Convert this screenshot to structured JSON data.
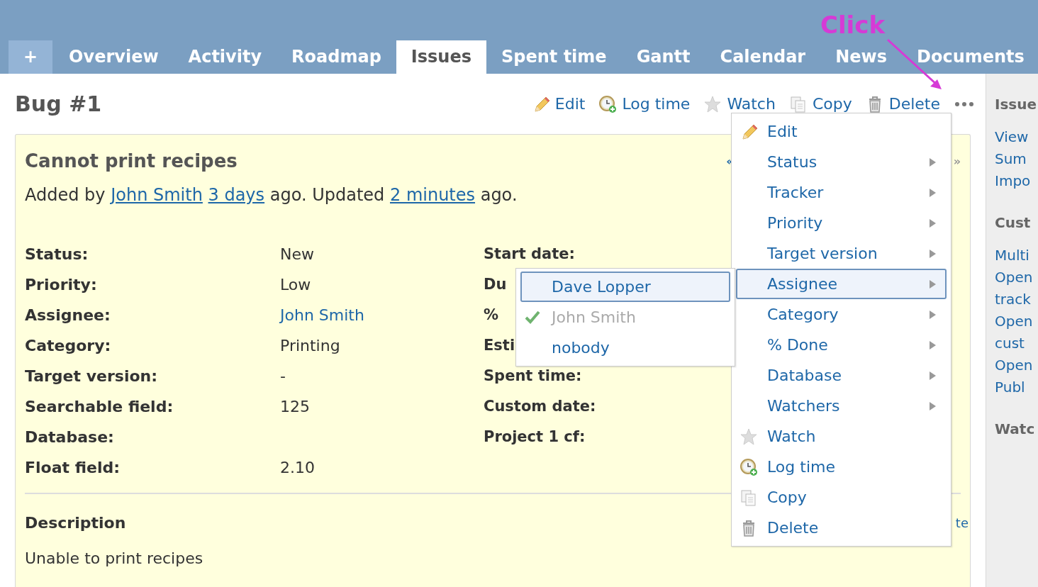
{
  "tabs": [
    {
      "label": "+",
      "kind": "new",
      "selected": false
    },
    {
      "label": "Overview",
      "kind": "tab",
      "selected": false
    },
    {
      "label": "Activity",
      "kind": "tab",
      "selected": false
    },
    {
      "label": "Roadmap",
      "kind": "tab",
      "selected": false
    },
    {
      "label": "Issues",
      "kind": "tab",
      "selected": true
    },
    {
      "label": "Spent time",
      "kind": "tab",
      "selected": false
    },
    {
      "label": "Gantt",
      "kind": "tab",
      "selected": false
    },
    {
      "label": "Calendar",
      "kind": "tab",
      "selected": false
    },
    {
      "label": "News",
      "kind": "tab",
      "selected": false
    },
    {
      "label": "Documents",
      "kind": "tab",
      "selected": false
    }
  ],
  "annotation": {
    "text": "Click"
  },
  "issue": {
    "title": "Bug #1",
    "actions": [
      {
        "label": "Edit",
        "kind": "pencil"
      },
      {
        "label": "Log time",
        "kind": "clock"
      },
      {
        "label": "Watch",
        "kind": "star"
      },
      {
        "label": "Copy",
        "kind": "copy"
      },
      {
        "label": "Delete",
        "kind": "trash"
      }
    ],
    "subject": "Cannot print recipes",
    "prev_link": "«",
    "next_link": "»",
    "byline": [
      {
        "text": "Added by"
      },
      {
        "text": "John Smith",
        "link": true
      },
      {
        "text": "3 days",
        "link": true
      },
      {
        "text": "ago. Updated"
      },
      {
        "text": "2 minutes",
        "link": true
      },
      {
        "text": "ago."
      }
    ],
    "attributes_left": [
      {
        "label": "Status:",
        "value": "New"
      },
      {
        "label": "Priority:",
        "value": "Low"
      },
      {
        "label": "Assignee:",
        "value": "John Smith",
        "link": true
      },
      {
        "label": "Category:",
        "value": "Printing"
      },
      {
        "label": "Target version:",
        "value": "-"
      },
      {
        "label": "Searchable field:",
        "value": "125"
      },
      {
        "label": "Database:"
      },
      {
        "label": "Float field:",
        "value": "2.10"
      }
    ],
    "attributes_right": [
      {
        "label": "Start date:"
      },
      {
        "label": "Du"
      },
      {
        "label": "%"
      },
      {
        "label": "Esti"
      },
      {
        "label": "Spent time:"
      },
      {
        "label": "Custom date:"
      },
      {
        "label": "Project 1 cf:"
      }
    ],
    "description_heading": "Description",
    "quote_link": "te",
    "description": "Unable to print recipes"
  },
  "context_menu": [
    {
      "label": "Edit",
      "kind": "pencil",
      "selected": false
    },
    {
      "label": "Status",
      "kind": "submenu",
      "selected": false
    },
    {
      "label": "Tracker",
      "kind": "submenu",
      "selected": false
    },
    {
      "label": "Priority",
      "kind": "submenu",
      "selected": false
    },
    {
      "label": "Target version",
      "kind": "submenu",
      "selected": false
    },
    {
      "label": "Assignee",
      "kind": "submenu",
      "selected": true
    },
    {
      "label": "Category",
      "kind": "submenu",
      "selected": false
    },
    {
      "label": "% Done",
      "kind": "submenu",
      "selected": false
    },
    {
      "label": "Database",
      "kind": "submenu",
      "selected": false
    },
    {
      "label": "Watchers",
      "kind": "submenu",
      "selected": false
    },
    {
      "label": "Watch",
      "kind": "star",
      "selected": false
    },
    {
      "label": "Log time",
      "kind": "clock",
      "selected": false
    },
    {
      "label": "Copy",
      "kind": "copy",
      "selected": false
    },
    {
      "label": "Delete",
      "kind": "trash",
      "selected": false
    }
  ],
  "submenu": [
    {
      "label": "Dave Lopper",
      "selected": true,
      "checked": false
    },
    {
      "label": "John Smith",
      "selected": false,
      "checked": true
    },
    {
      "label": "nobody",
      "selected": false,
      "checked": false
    }
  ],
  "sidebar": [
    {
      "text": "Issue",
      "kind": "heading"
    },
    {
      "text": "View",
      "kind": "link"
    },
    {
      "text": "Sum",
      "kind": "link"
    },
    {
      "text": "Impo",
      "kind": "link"
    },
    {
      "text": "Cust",
      "kind": "heading"
    },
    {
      "text": "Multi",
      "kind": "link"
    },
    {
      "text": "Open",
      "kind": "link"
    },
    {
      "text": "track",
      "kind": "link"
    },
    {
      "text": "Open",
      "kind": "link"
    },
    {
      "text": "cust",
      "kind": "link"
    },
    {
      "text": "Open",
      "kind": "link"
    },
    {
      "text": "Publ",
      "kind": "link"
    },
    {
      "text": "Watc",
      "kind": "heading"
    }
  ]
}
